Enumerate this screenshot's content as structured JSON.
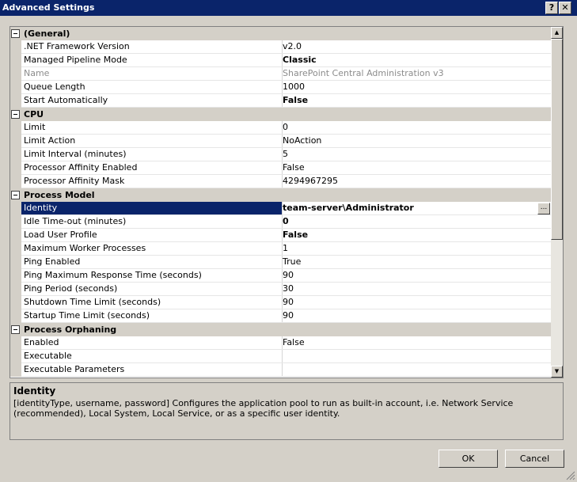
{
  "window": {
    "title": "Advanced Settings",
    "help_label": "?",
    "close_label": "✕"
  },
  "grid": {
    "rows": [
      {
        "kind": "category",
        "label": "(General)"
      },
      {
        "kind": "prop",
        "name": ".NET Framework Version",
        "value": "v2.0"
      },
      {
        "kind": "prop",
        "name": "Managed Pipeline Mode",
        "value": "Classic",
        "bold": true
      },
      {
        "kind": "prop",
        "name": "Name",
        "value": "SharePoint Central Administration v3",
        "disabled": true
      },
      {
        "kind": "prop",
        "name": "Queue Length",
        "value": "1000"
      },
      {
        "kind": "prop",
        "name": "Start Automatically",
        "value": "False",
        "bold": true
      },
      {
        "kind": "category",
        "label": "CPU"
      },
      {
        "kind": "prop",
        "name": "Limit",
        "value": "0"
      },
      {
        "kind": "prop",
        "name": "Limit Action",
        "value": "NoAction"
      },
      {
        "kind": "prop",
        "name": "Limit Interval (minutes)",
        "value": "5"
      },
      {
        "kind": "prop",
        "name": "Processor Affinity Enabled",
        "value": "False"
      },
      {
        "kind": "prop",
        "name": "Processor Affinity Mask",
        "value": "4294967295"
      },
      {
        "kind": "category",
        "label": "Process Model"
      },
      {
        "kind": "prop",
        "name": "Identity",
        "value": "team-server\\Administrator",
        "selected": true,
        "button": "..."
      },
      {
        "kind": "prop",
        "name": "Idle Time-out (minutes)",
        "value": "0",
        "bold": true
      },
      {
        "kind": "prop",
        "name": "Load User Profile",
        "value": "False",
        "bold": true
      },
      {
        "kind": "prop",
        "name": "Maximum Worker Processes",
        "value": "1"
      },
      {
        "kind": "prop",
        "name": "Ping Enabled",
        "value": "True"
      },
      {
        "kind": "prop",
        "name": "Ping Maximum Response Time (seconds)",
        "value": "90"
      },
      {
        "kind": "prop",
        "name": "Ping Period (seconds)",
        "value": "30"
      },
      {
        "kind": "prop",
        "name": "Shutdown Time Limit (seconds)",
        "value": "90"
      },
      {
        "kind": "prop",
        "name": "Startup Time Limit (seconds)",
        "value": "90"
      },
      {
        "kind": "category",
        "label": "Process Orphaning"
      },
      {
        "kind": "prop",
        "name": "Enabled",
        "value": "False"
      },
      {
        "kind": "prop",
        "name": "Executable",
        "value": ""
      },
      {
        "kind": "prop",
        "name": "Executable Parameters",
        "value": ""
      }
    ]
  },
  "description": {
    "title": "Identity",
    "text": "[identityType, username, password] Configures the application pool to run as built-in account, i.e. Network Service (recommended), Local System, Local Service, or as a specific user identity."
  },
  "buttons": {
    "ok": "OK",
    "cancel": "Cancel"
  },
  "icons": {
    "scroll_up": "scroll-up-arrow-icon",
    "scroll_down": "scroll-down-arrow-icon",
    "collapse": "collapse-minus-icon",
    "grip": "resize-grip-icon"
  }
}
